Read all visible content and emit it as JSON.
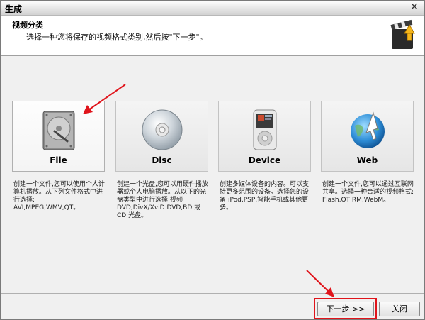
{
  "window": {
    "title": "生成",
    "close_glyph": "✕"
  },
  "header": {
    "title": "视频分类",
    "subtitle": "选择一种您将保存的视频格式类别,然后按\"下一步\"。"
  },
  "categories": [
    {
      "label": "File",
      "icon": "hard-drive-icon",
      "selected": true,
      "description": "创建一个文件,您可以使用个人计算机播放。从下列文件格式中进行选择:\nAVI,MPEG,WMV,QT。"
    },
    {
      "label": "Disc",
      "icon": "optical-disc-icon",
      "selected": false,
      "description": "创建一个光盘,您可以用硬件播放器或个人电脑播放。从以下的光盘类型中进行选择:视频 DVD,DivX/XviD DVD,BD 或 CD 光盘。"
    },
    {
      "label": "Device",
      "icon": "media-player-icon",
      "selected": false,
      "description": "创建多媒体设备的内容。可以支持更多范围的设备。选择您的设备:iPod,PSP,智能手机或其他更多。"
    },
    {
      "label": "Web",
      "icon": "globe-icon",
      "selected": false,
      "description": "创建一个文件,您可以通过互联网共享。选择一种合适的视频格式:\nFlash,QT,RM,WebM。"
    }
  ],
  "buttons": {
    "next": "下一步 >>",
    "close": "关闭"
  },
  "colors": {
    "annotation_red": "#e0141b"
  }
}
